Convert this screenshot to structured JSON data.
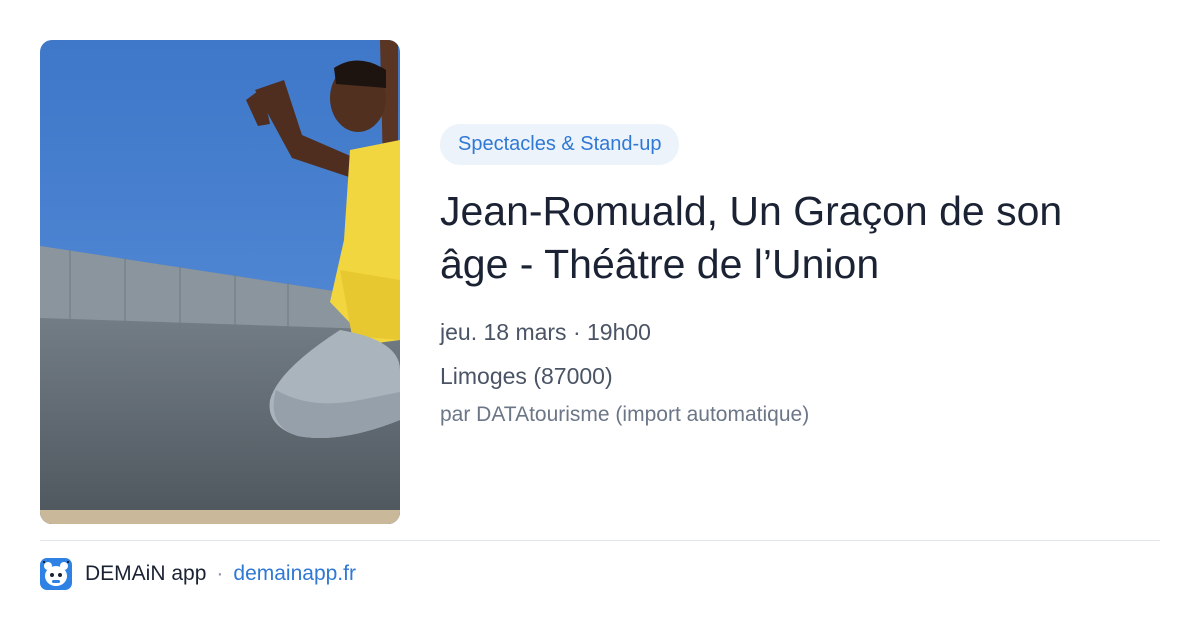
{
  "event": {
    "category": "Spectacles & Stand-up",
    "title": "Jean-Romuald, Un Graçon de son âge - Théâtre de l’Union",
    "date": "jeu. 18 mars · 19h00",
    "location": "Limoges (87000)",
    "source": "par DATAtourisme (import automatique)",
    "image_icon": "photo-dancer-jumping"
  },
  "footer": {
    "app_name": "DEMAiN app",
    "separator": "·",
    "domain": "demainapp.fr",
    "logo_icon": "demain-app-logo-icon"
  },
  "colors": {
    "accent": "#2f78d4",
    "category_bg": "#edf3fb",
    "title": "#1a2233",
    "meta": "#4a5465",
    "divider": "#dfe5ec"
  }
}
